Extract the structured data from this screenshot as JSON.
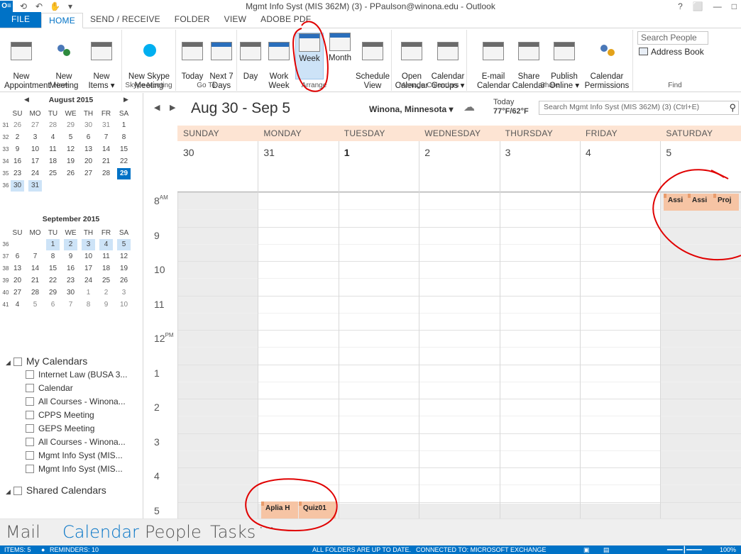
{
  "window": {
    "title": "Mgmt Info Syst (MIS 362M) (3) - PPaulson@winona.edu - Outlook",
    "controls": [
      "?",
      "⬜",
      "—",
      "□"
    ]
  },
  "tabs": [
    {
      "label": "FILE"
    },
    {
      "label": "HOME"
    },
    {
      "label": "SEND / RECEIVE"
    },
    {
      "label": "FOLDER"
    },
    {
      "label": "VIEW"
    },
    {
      "label": "ADOBE PDF"
    }
  ],
  "ribbon": {
    "new_appointment": "New\nAppointment",
    "new_meeting": "New\nMeeting",
    "new_items": "New\nItems ▾",
    "group_new": "New",
    "new_skype_meeting": "New Skype\nMeeting",
    "group_skype": "Skype Meeting",
    "today": "Today",
    "next7": "Next 7\nDays",
    "group_goto": "Go To",
    "day": "Day",
    "work_week": "Work\nWeek",
    "week": "Week",
    "month": "Month",
    "schedule_view": "Schedule\nView",
    "group_arrange": "Arrange",
    "open_calendar": "Open\nCalendar ▾",
    "calendar_groups": "Calendar\nGroups ▾",
    "group_manage": "Manage Calendars",
    "email_calendar": "E-mail\nCalendar",
    "share_calendar": "Share\nCalendar",
    "publish_online": "Publish\nOnline ▾",
    "calendar_permissions": "Calendar\nPermissions",
    "group_share": "Share",
    "search_people": "Search People",
    "address_book": "Address Book",
    "group_find": "Find"
  },
  "minicals": [
    {
      "title": "August 2015",
      "dow": [
        "SU",
        "MO",
        "TU",
        "WE",
        "TH",
        "FR",
        "SA"
      ],
      "weeks": [
        {
          "wk": "31",
          "days": [
            "26",
            "27",
            "28",
            "29",
            "30",
            "31",
            "1"
          ]
        },
        {
          "wk": "32",
          "days": [
            "2",
            "3",
            "4",
            "5",
            "6",
            "7",
            "8"
          ]
        },
        {
          "wk": "33",
          "days": [
            "9",
            "10",
            "11",
            "12",
            "13",
            "14",
            "15"
          ]
        },
        {
          "wk": "34",
          "days": [
            "16",
            "17",
            "18",
            "19",
            "20",
            "21",
            "22"
          ]
        },
        {
          "wk": "35",
          "days": [
            "23",
            "24",
            "25",
            "26",
            "27",
            "28",
            "29"
          ]
        },
        {
          "wk": "36",
          "days": [
            "30",
            "31",
            "",
            "",
            "",
            "",
            ""
          ]
        }
      ]
    },
    {
      "title": "September 2015",
      "dow": [
        "SU",
        "MO",
        "TU",
        "WE",
        "TH",
        "FR",
        "SA"
      ],
      "weeks": [
        {
          "wk": "36",
          "days": [
            "",
            "",
            "1",
            "2",
            "3",
            "4",
            "5"
          ]
        },
        {
          "wk": "37",
          "days": [
            "6",
            "7",
            "8",
            "9",
            "10",
            "11",
            "12"
          ]
        },
        {
          "wk": "38",
          "days": [
            "13",
            "14",
            "15",
            "16",
            "17",
            "18",
            "19"
          ]
        },
        {
          "wk": "39",
          "days": [
            "20",
            "21",
            "22",
            "23",
            "24",
            "25",
            "26"
          ]
        },
        {
          "wk": "40",
          "days": [
            "27",
            "28",
            "29",
            "30",
            "1",
            "2",
            "3"
          ]
        },
        {
          "wk": "41",
          "days": [
            "4",
            "5",
            "6",
            "7",
            "8",
            "9",
            "10"
          ]
        }
      ]
    }
  ],
  "my_calendars": {
    "header": "My Calendars",
    "items": [
      "Internet Law (BUSA 3...",
      "Calendar",
      "All Courses - Winona...",
      "CPPS Meeting",
      "GEPS Meeting",
      "All Courses - Winona...",
      "Mgmt Info Syst (MIS...",
      "Mgmt Info Syst (MIS..."
    ]
  },
  "shared_calendars": {
    "header": "Shared Calendars"
  },
  "calendar": {
    "range": "Aug 30 - Sep 5",
    "location": "Winona, Minnesota ▾",
    "today_label": "Today",
    "temperature": "77°F/62°F",
    "search_placeholder": "Search Mgmt Info Syst (MIS 362M) (3) (Ctrl+E)",
    "days": [
      {
        "name": "SUNDAY",
        "num": "30"
      },
      {
        "name": "MONDAY",
        "num": "31"
      },
      {
        "name": "TUESDAY",
        "num": "1"
      },
      {
        "name": "WEDNESDAY",
        "num": "2"
      },
      {
        "name": "THURSDAY",
        "num": "3"
      },
      {
        "name": "FRIDAY",
        "num": "4"
      },
      {
        "name": "SATURDAY",
        "num": "5"
      }
    ],
    "hours": [
      {
        "h": "8",
        "ampm": "AM"
      },
      {
        "h": "9",
        "ampm": ""
      },
      {
        "h": "10",
        "ampm": ""
      },
      {
        "h": "11",
        "ampm": ""
      },
      {
        "h": "12",
        "ampm": "PM"
      },
      {
        "h": "1",
        "ampm": ""
      },
      {
        "h": "2",
        "ampm": ""
      },
      {
        "h": "3",
        "ampm": ""
      },
      {
        "h": "4",
        "ampm": ""
      },
      {
        "h": "5",
        "ampm": ""
      }
    ],
    "events": {
      "sat_1": "Assi",
      "sat_2": "Assi",
      "sat_3": "Proj",
      "mon_1": "Aplia H",
      "mon_2": "Quiz01"
    }
  },
  "bottom_nav": {
    "mail": "Mail",
    "calendar": "Calendar",
    "people": "People",
    "tasks": "Tasks",
    "more": "···"
  },
  "status": {
    "items": "ITEMS: 5",
    "reminders": "REMINDERS: 10",
    "sync": "ALL FOLDERS ARE UP TO DATE.",
    "connection": "CONNECTED TO: MICROSOFT EXCHANGE",
    "zoom": "100%"
  },
  "colors": {
    "accent": "#0072c6",
    "day_header": "#fde4d3",
    "event": "#f6c4a4",
    "annotation": "#e00000"
  }
}
